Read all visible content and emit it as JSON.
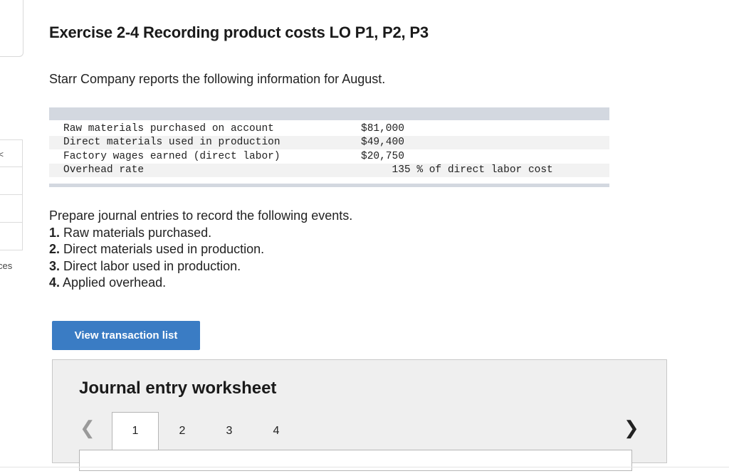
{
  "sidebar": {
    "mark": "<",
    "label": "ces"
  },
  "exercise": {
    "title": "Exercise 2-4 Recording product costs LO P1, P2, P3",
    "intro": "Starr Company reports the following information for August."
  },
  "info_rows": [
    {
      "label": "Raw materials purchased on account",
      "value": "$81,000"
    },
    {
      "label": "Direct materials used in production",
      "value": "$49,400"
    },
    {
      "label": "Factory wages earned (direct labor)",
      "value": "$20,750"
    },
    {
      "label": "Overhead rate",
      "value": "     135 % of direct labor cost"
    }
  ],
  "instructions": {
    "heading": "Prepare journal entries to record the following events.",
    "items": [
      {
        "num": "1.",
        "text": " Raw materials purchased."
      },
      {
        "num": "2.",
        "text": " Direct materials used in production."
      },
      {
        "num": "3.",
        "text": " Direct labor used in production."
      },
      {
        "num": "4.",
        "text": " Applied overhead."
      }
    ]
  },
  "view_button_label": "View transaction list",
  "worksheet": {
    "title": "Journal entry worksheet",
    "prev_icon": "chevron-left-icon",
    "next_icon": "chevron-right-icon",
    "tabs": [
      "1",
      "2",
      "3",
      "4"
    ],
    "active_tab": "1"
  },
  "colors": {
    "button": "#3a7cc4",
    "table_bar": "#d3d8e0",
    "worksheet_bg": "#efefef"
  }
}
